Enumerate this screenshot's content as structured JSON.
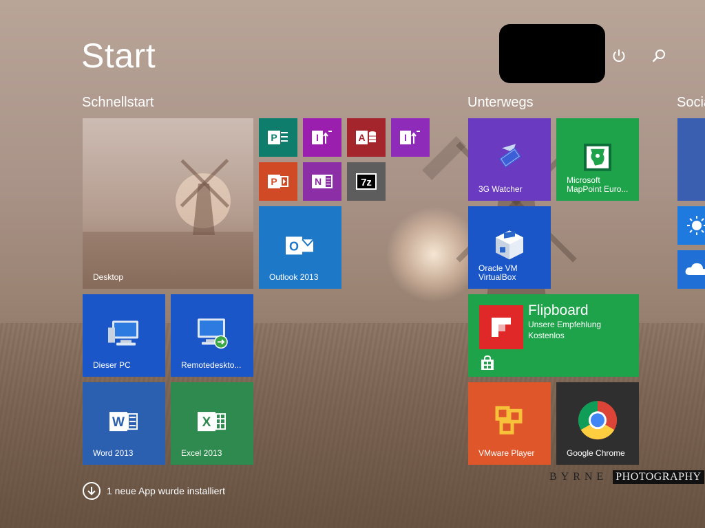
{
  "header": {
    "title": "Start"
  },
  "groups": {
    "quick": "Schnellstart",
    "onthego": "Unterwegs",
    "social": "Socia"
  },
  "tiles": {
    "desktop": "Desktop",
    "outlook": "Outlook 2013",
    "dieser_pc": "Dieser PC",
    "remote": "Remotedeskto...",
    "word": "Word 2013",
    "excel": "Excel 2013",
    "watcher": "3G Watcher",
    "mappoint": "Microsoft\nMapPoint Euro...",
    "virtualbox": "Oracle VM\nVirtualBox",
    "flipboard": {
      "title": "Flipboard",
      "line1": "Unsere Empfehlung",
      "line2": "Kostenlos"
    },
    "vmware": "VMware Player",
    "chrome": "Google Chrome"
  },
  "notification": "1 neue App wurde installiert",
  "watermark": {
    "left": "BYRNE",
    "right": "PHOTOGRAPHY"
  },
  "colors": {
    "project": "#0e7d6c",
    "onenote": "#8c2ea6",
    "access": "#a4262c",
    "infopath": "#8e2bb8",
    "powerpoint": "#d04a25",
    "sevenzip": "#5d5d5d",
    "outlook": "#1e78c8",
    "blue": "#1a56c8",
    "word": "#2b579a",
    "excel": "#217346",
    "purple": "#6a3ac0",
    "green": "#1ea34a",
    "orange": "#e0562b",
    "dark": "#2f2f2f"
  }
}
